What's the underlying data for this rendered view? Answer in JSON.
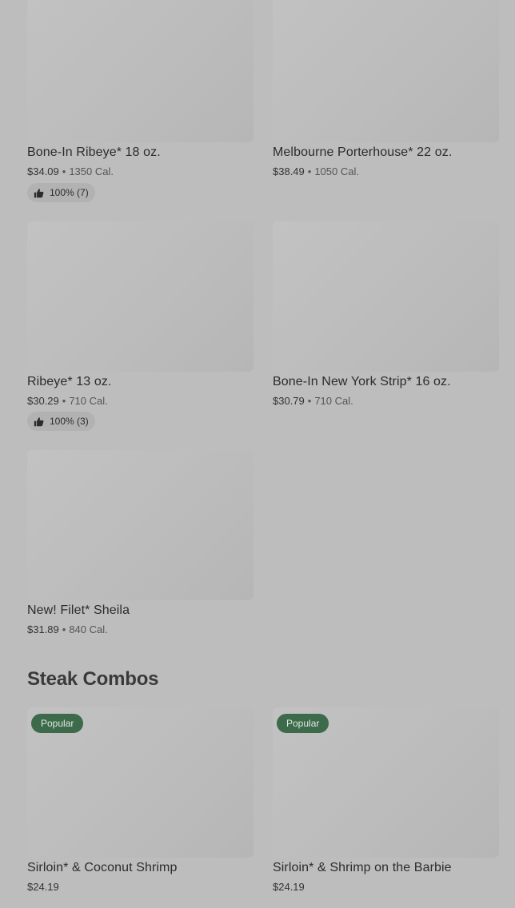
{
  "items": [
    {
      "name": "Bone-In Ribeye* 18 oz.",
      "price": "$34.09",
      "calories": "1350 Cal.",
      "rating": "100% (7)"
    },
    {
      "name": "Melbourne Porterhouse* 22 oz.",
      "price": "$38.49",
      "calories": "1050 Cal."
    },
    {
      "name": "Ribeye* 13 oz.",
      "price": "$30.29",
      "calories": "710 Cal.",
      "rating": "100% (3)"
    },
    {
      "name": "Bone-In New York Strip* 16 oz.",
      "price": "$30.79",
      "calories": "710 Cal."
    },
    {
      "name": "New! Filet* Sheila",
      "price": "$31.89",
      "calories": "840 Cal."
    }
  ],
  "combos_section": {
    "title": "Steak Combos",
    "items": [
      {
        "badge": "Popular",
        "name": "Sirloin* & Coconut Shrimp",
        "price": "$24.19"
      },
      {
        "badge": "Popular",
        "name": "Sirloin* & Shrimp on the Barbie",
        "price": "$24.19"
      }
    ]
  },
  "separator": "•",
  "icons": {
    "rating": "thumbs-up-icon"
  }
}
